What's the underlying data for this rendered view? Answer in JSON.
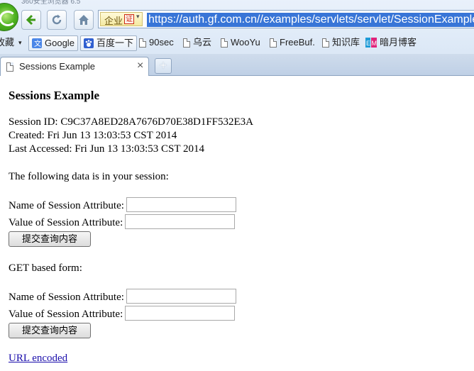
{
  "browser": {
    "window_title": "360安全浏览器 6.5",
    "enterprise_label": "企业",
    "cert_label": "证",
    "address_url": "https://auth.gf.com.cn//examples/servlets/servlet/SessionExample",
    "bookmarks": [
      {
        "label": "收藏"
      },
      {
        "label": "Google"
      },
      {
        "label": "百度一下"
      },
      {
        "label": "90sec"
      },
      {
        "label": "乌云"
      },
      {
        "label": "WooYu"
      },
      {
        "label": "FreeBuf."
      },
      {
        "label": "知识库"
      },
      {
        "label": "暗月博客"
      }
    ],
    "tab": {
      "title": "Sessions Example",
      "close": "×"
    },
    "new_tab": "+"
  },
  "page": {
    "heading": "Sessions Example",
    "session_id": "Session ID: C9C37A8ED28A7676D70E38D1FF532E3A",
    "created": "Created: Fri Jun 13 13:03:53 CST 2014",
    "last_accessed": "Last Accessed: Fri Jun 13 13:03:53 CST 2014",
    "session_data_intro": "The following data is in your session:",
    "post_form": {
      "name_label": "Name of Session Attribute:",
      "value_label": "Value of Session Attribute:",
      "name_value": "",
      "value_value": "",
      "submit_label": "提交查询内容"
    },
    "get_form_title": "GET based form:",
    "get_form": {
      "name_label": "Name of Session Attribute:",
      "value_label": "Value of Session Attribute:",
      "name_value": "",
      "value_value": "",
      "submit_label": "提交查询内容"
    },
    "url_encoded_link": "URL encoded"
  },
  "colors": {
    "link": "#1a0dab",
    "address_highlight": "#3875d7",
    "chrome_bg": "#d6e4f4"
  }
}
